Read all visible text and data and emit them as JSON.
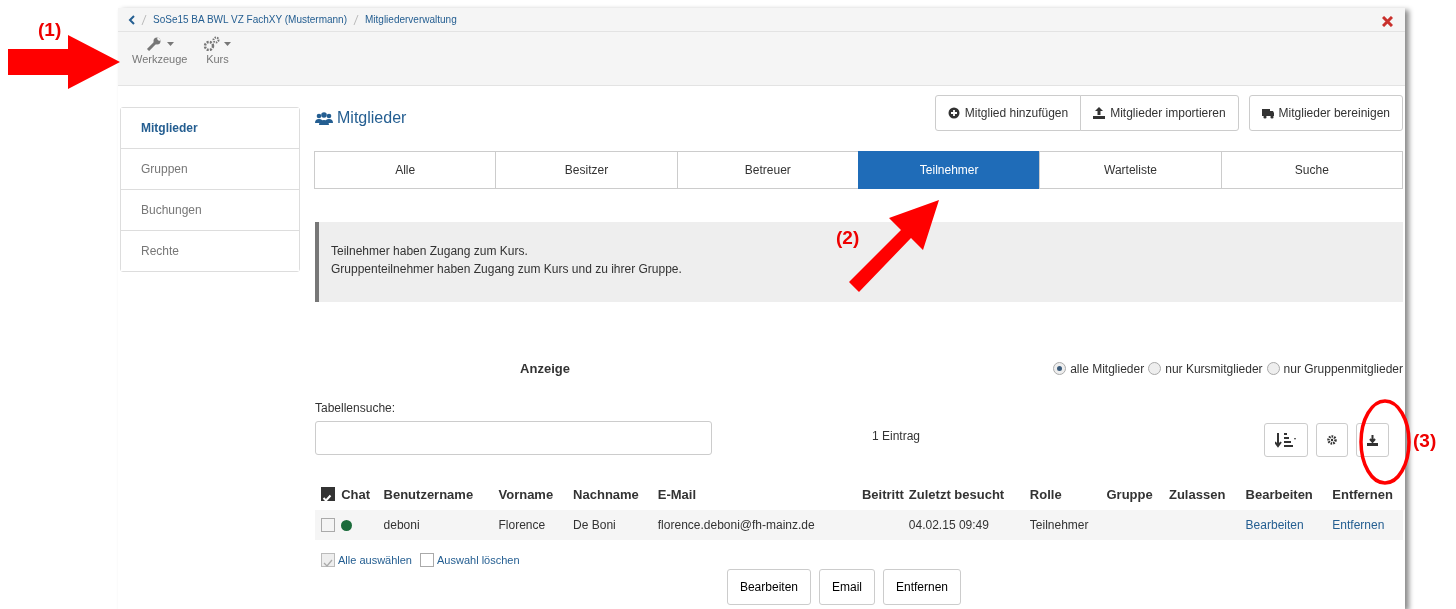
{
  "breadcrumb": [
    "SoSe15 BA BWL VZ FachXY (Mustermann)",
    "Mitgliederverwaltung"
  ],
  "toolbar": [
    {
      "label": "Werkzeuge",
      "kind": "wrench"
    },
    {
      "label": "Kurs",
      "kind": "gears"
    }
  ],
  "sidebar": [
    {
      "label": "Mitglieder",
      "selected": true
    },
    {
      "label": "Gruppen",
      "selected": false
    },
    {
      "label": "Buchungen",
      "selected": false
    },
    {
      "label": "Rechte",
      "selected": false
    }
  ],
  "heading": "Mitglieder",
  "actions": [
    {
      "label": "Mitglied hinzufügen",
      "kind": "add"
    },
    {
      "label": "Mitglieder importieren",
      "kind": "import"
    },
    {
      "label": "Mitglieder bereinigen",
      "kind": "clean"
    }
  ],
  "tabs": [
    {
      "label": "Alle",
      "selected": false
    },
    {
      "label": "Besitzer",
      "selected": false
    },
    {
      "label": "Betreuer",
      "selected": false
    },
    {
      "label": "Teilnehmer",
      "selected": true
    },
    {
      "label": "Warteliste",
      "selected": false
    },
    {
      "label": "Suche",
      "selected": false
    }
  ],
  "info": [
    "Teilnehmer haben Zugang zum Kurs.",
    "Gruppenteilnehmer haben Zugang zum Kurs und zu ihrer Gruppe."
  ],
  "filter": {
    "label": "Anzeige",
    "options": [
      {
        "label": "alle Mitglieder",
        "selected": true
      },
      {
        "label": "nur Kursmitglieder",
        "selected": false
      },
      {
        "label": "nur Gruppenmitglieder",
        "selected": false
      }
    ]
  },
  "table_search": {
    "label": "Tabellensuche:"
  },
  "count": "1 Eintrag",
  "table": {
    "select_all_checked": true,
    "columns": [
      "Chat",
      "Benutzername",
      "Vorname",
      "Nachname",
      "E-Mail",
      "Beitritt",
      "Zuletzt besucht",
      "Rolle",
      "Gruppe",
      "Zulassen",
      "Bearbeiten",
      "Entfernen"
    ],
    "rows": [
      {
        "checked": false,
        "online": true,
        "username": "deboni",
        "first_name": "Florence",
        "last_name": "De Boni",
        "email": "florence.deboni@fh-mainz.de",
        "last_visit": "04.02.15 09:49",
        "role": "Teilnehmer",
        "edit": "Bearbeiten",
        "remove": "Entfernen"
      }
    ]
  },
  "selection": [
    {
      "label": "Alle auswählen",
      "checked": true,
      "disabled": true
    },
    {
      "label": "Auswahl löschen",
      "checked": false,
      "disabled": false
    }
  ],
  "bottom_buttons": [
    "Bearbeiten",
    "Email",
    "Entfernen"
  ],
  "annotations": [
    {
      "label": "(1)",
      "kind": "arrow-right"
    },
    {
      "label": "(2)",
      "kind": "arrow-diagonal"
    },
    {
      "label": "(3)",
      "kind": "ring"
    }
  ]
}
